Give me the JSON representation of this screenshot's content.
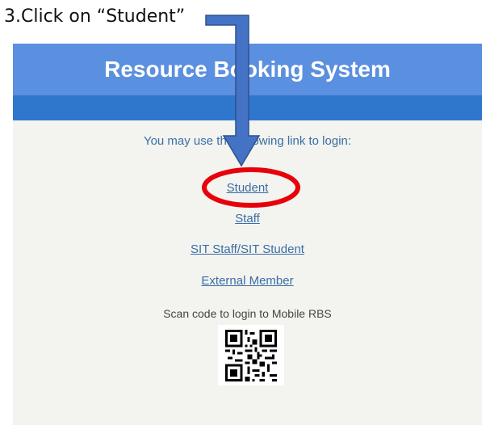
{
  "instruction": "3.Click on “Student”",
  "header": {
    "title": "Resource Booking System"
  },
  "login": {
    "prompt": "You may use the following link to login:",
    "student_label": "Student",
    "staff_label": "Staff",
    "sit_staff_label": "SIT Staff",
    "separator": "/",
    "sit_student_label": "SIT Student",
    "external_label": "External Member",
    "scan_text": "Scan code to login to Mobile RBS"
  },
  "icons": {
    "qr": "qr-code-icon",
    "arrow": "down-arrow-annotation",
    "circle": "highlight-circle"
  },
  "colors": {
    "header": "#5b8fdf",
    "subbar": "#2f77cc",
    "link": "#3a6ea5",
    "highlight": "#e8000b",
    "arrow": "#4472c4"
  }
}
